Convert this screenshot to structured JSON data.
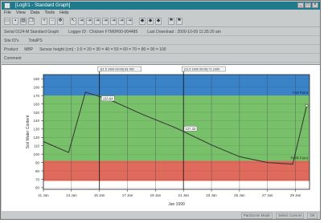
{
  "window": {
    "title": "[Logfr1 - Standard Graph]"
  },
  "menu": [
    "File",
    "View",
    "Data",
    "Tools",
    "Help"
  ],
  "toolbar": {
    "buttons": [
      {
        "icon": "open-icon"
      },
      {
        "icon": "save-icon"
      },
      {
        "icon": "print-icon"
      },
      {
        "icon": "copy-icon"
      },
      {
        "icon": "zoom-in-icon"
      },
      {
        "icon": "zoom-out-icon"
      },
      {
        "icon": "pan-icon"
      },
      {
        "icon": "cursor-icon"
      },
      {
        "icon": "range-icon"
      },
      {
        "icon": "range-icon"
      },
      {
        "icon": "range-icon"
      },
      {
        "icon": "range-icon"
      },
      {
        "icon": "range-icon"
      },
      {
        "icon": "range-icon"
      },
      {
        "icon": "range-icon"
      },
      {
        "icon": "marker-icon"
      },
      {
        "icon": "marker-icon"
      },
      {
        "icon": "marker-icon"
      },
      {
        "icon": "flag-icon"
      },
      {
        "icon": "flag-icon"
      }
    ]
  },
  "info": {
    "row1": [
      "Serial 0124-M Standard Graph",
      "Logger ID : Chicken FTM0H00-004485",
      "Last Download : 2000-10-09 11:35:20 am"
    ],
    "row2": [
      "Site ID's",
      "TotalPS"
    ],
    "row3": [
      "Product",
      "MBP",
      "Sensor height (cm) : 1:0 = 20 = 30 = 40 = 50 = 60 = 70 = 80 = 90 = 100"
    ],
    "row4": [
      "Comment",
      ""
    ]
  },
  "chart_data": {
    "type": "line",
    "ylabel": "Soil Water Content",
    "xlabel": "Jan 1999",
    "x_ticks": [
      "11 Jan",
      "13 Jan",
      "15 Jan",
      "17 Jan",
      "19 Jan",
      "21 Jan",
      "23 Jan",
      "25 Jan",
      "27 Jan",
      "29 Jan"
    ],
    "y_ticks": [
      60,
      70,
      80,
      90,
      100,
      110,
      120,
      130,
      140,
      150,
      160,
      170,
      180,
      190
    ],
    "ylim": [
      58,
      195
    ],
    "xlim": [
      11,
      30
    ],
    "bands": [
      {
        "name": "Full Point",
        "from": 170,
        "to": 195,
        "color": "#3a83c8"
      },
      {
        "name": "",
        "from": 92,
        "to": 170,
        "color": "#79c06a"
      },
      {
        "name": "Refill Point",
        "from": 68,
        "to": 92,
        "color": "#e06a5c"
      }
    ],
    "series": [
      {
        "color": "#333333",
        "points": [
          [
            11,
            115
          ],
          [
            12.8,
            102
          ],
          [
            14,
            174
          ],
          [
            14.8,
            170
          ],
          [
            16,
            163
          ],
          [
            18,
            148
          ],
          [
            20.5,
            131
          ],
          [
            23,
            111
          ],
          [
            25,
            97
          ],
          [
            27,
            90
          ],
          [
            28.8,
            88
          ],
          [
            29.8,
            158
          ]
        ]
      }
    ],
    "markers": [
      {
        "label": "[11.5 1999 09:00] 63.780",
        "x": 15
      },
      {
        "label": "[11.5 1999 09:00] 71.1000",
        "x": 21
      }
    ],
    "data_labels": [
      {
        "text": "163.84",
        "x": 15.2,
        "y": 165
      },
      {
        "text": "127.32",
        "x": 21.1,
        "y": 129
      }
    ],
    "grid": true
  },
  "status": [
    "Pan/Zoom Mode",
    "Select Cursors",
    "OK"
  ]
}
